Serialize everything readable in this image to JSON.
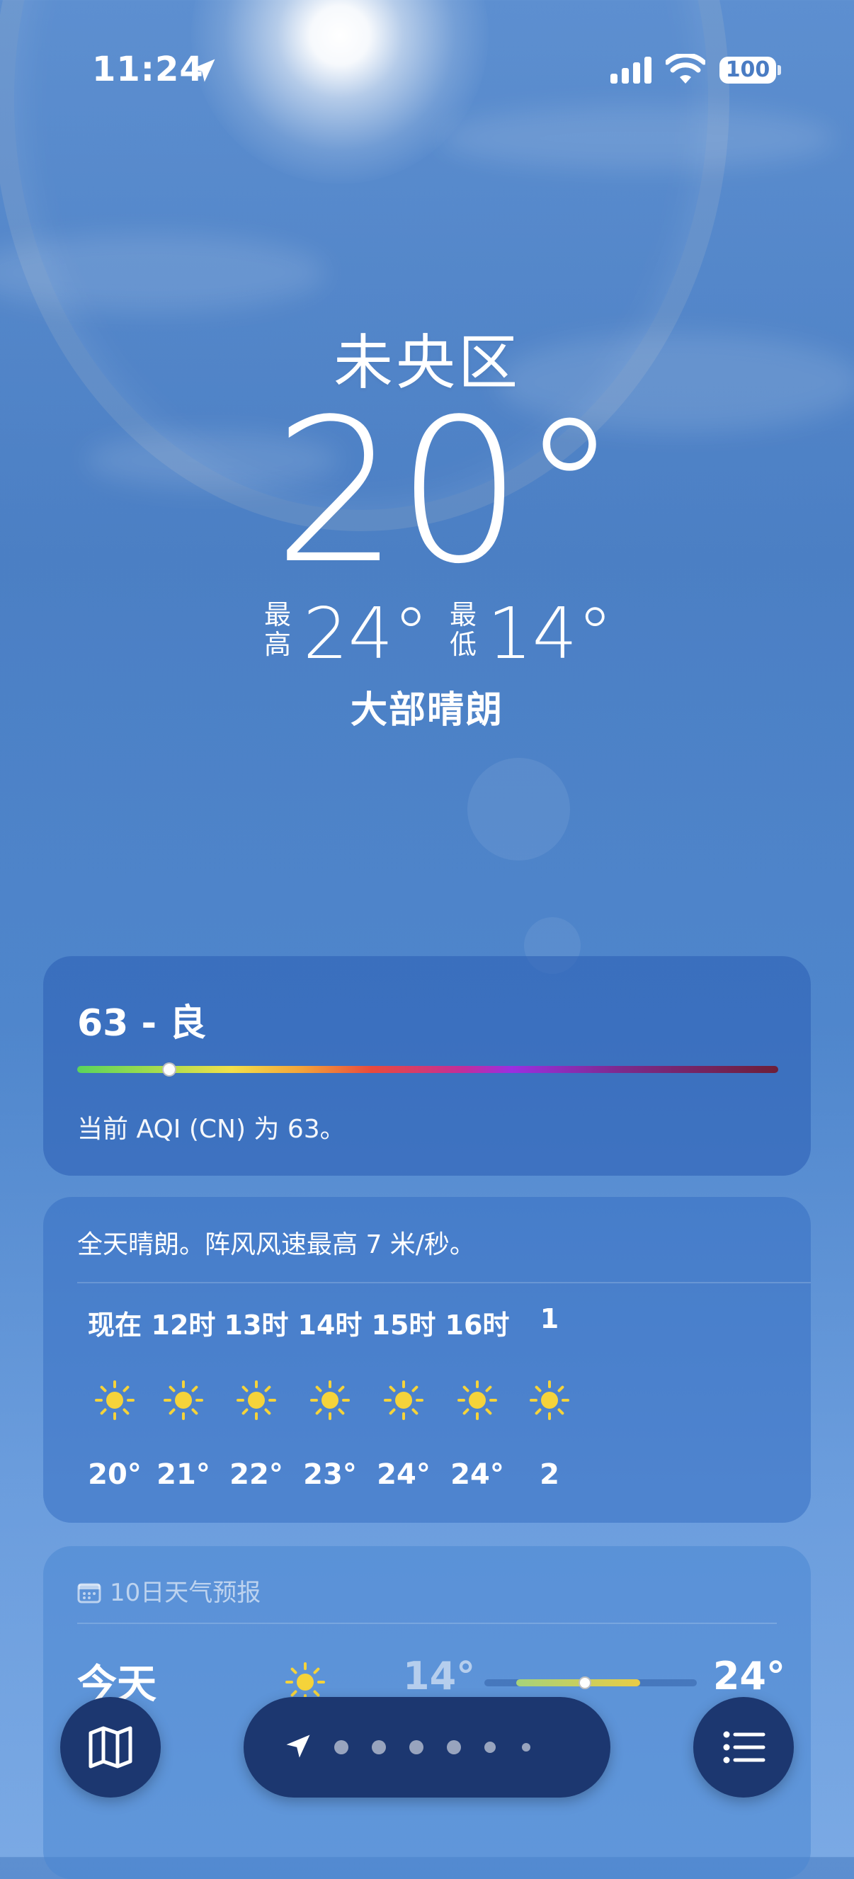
{
  "status_bar": {
    "time": "11:24",
    "location_icon": "location-arrow-icon",
    "signal_icon": "cellular-signal-icon",
    "wifi_icon": "wifi-icon",
    "battery": "100"
  },
  "hero": {
    "city": "未央区",
    "temperature": "20°",
    "high_label": "最高",
    "high": "24°",
    "low_label": "最低",
    "low": "14°",
    "condition": "大部晴朗"
  },
  "aqi": {
    "title": "63 - 良",
    "description": "当前 AQI (CN) 为 63。",
    "value": 63
  },
  "hourly": {
    "summary": "全天晴朗。阵风风速最高 7 米/秒。",
    "items": [
      {
        "hour": "现在",
        "icon": "sun-icon",
        "temp": "20°"
      },
      {
        "hour": "12时",
        "icon": "sun-icon",
        "temp": "21°"
      },
      {
        "hour": "13时",
        "icon": "sun-icon",
        "temp": "22°"
      },
      {
        "hour": "14时",
        "icon": "sun-icon",
        "temp": "23°"
      },
      {
        "hour": "15时",
        "icon": "sun-icon",
        "temp": "24°"
      },
      {
        "hour": "16时",
        "icon": "sun-icon",
        "temp": "24°"
      },
      {
        "hour": "1",
        "icon": "sun-icon",
        "temp": "2"
      }
    ]
  },
  "daily": {
    "header": "10日天气预报",
    "today": {
      "day": "今天",
      "icon": "sun-icon",
      "low": "14°",
      "high": "24°"
    }
  },
  "toolbar": {
    "map_icon": "map-icon",
    "list_icon": "list-icon",
    "page_count": 7,
    "current_page": 0
  },
  "colors": {
    "sun_yellow": "#f5d33a",
    "toolbar_bg": "#1c3770"
  }
}
